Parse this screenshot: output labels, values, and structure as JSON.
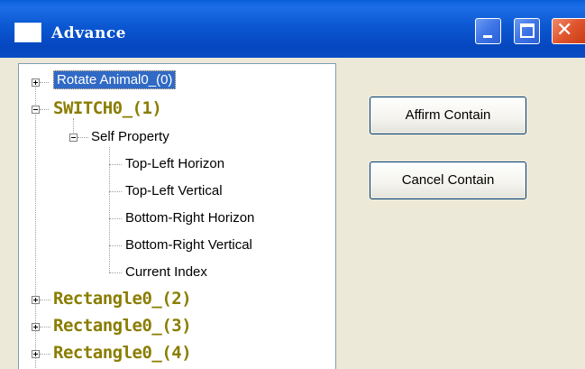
{
  "window": {
    "title": "Advance",
    "title_icon": "window-icon",
    "controls": {
      "minimize_icon": "minimize-icon",
      "maximize_icon": "maximize-icon",
      "close_icon": "close-icon",
      "close_glyph": "✕"
    }
  },
  "tree": {
    "nodes": [
      {
        "label": "Rotate Animal0_(0)",
        "state": "collapsed",
        "selected": true
      },
      {
        "label": "SWITCH0_(1)",
        "state": "expanded",
        "children": [
          {
            "label": "Self Property",
            "state": "expanded",
            "children": [
              {
                "label": "Top-Left Horizon"
              },
              {
                "label": "Top-Left Vertical"
              },
              {
                "label": "Bottom-Right Horizon"
              },
              {
                "label": "Bottom-Right Vertical"
              },
              {
                "label": "Current Index"
              }
            ]
          }
        ]
      },
      {
        "label": "Rectangle0_(2)",
        "state": "collapsed"
      },
      {
        "label": "Rectangle0_(3)",
        "state": "collapsed"
      },
      {
        "label": "Rectangle0_(4)",
        "state": "collapsed"
      }
    ]
  },
  "buttons": {
    "affirm_label": "Affirm Contain",
    "cancel_label": "Cancel Contain"
  },
  "colors": {
    "titlebar": "#0b58d2",
    "selection": "#316ac5",
    "object_label": "#8a7d00",
    "close_button": "#e0552e"
  }
}
